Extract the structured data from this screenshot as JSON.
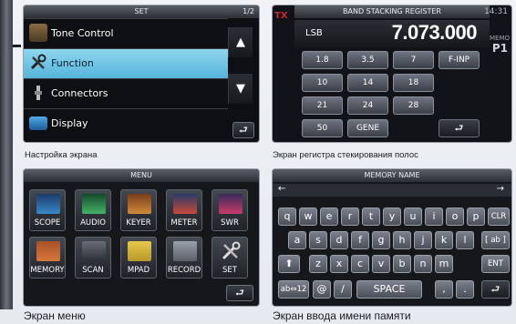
{
  "set_screen": {
    "title": "SET",
    "page_indicator": "1/2",
    "items": [
      {
        "label": "Tone Control",
        "icon": "speaker-icon",
        "selected": false
      },
      {
        "label": "Function",
        "icon": "tools-icon",
        "selected": true
      },
      {
        "label": "Connectors",
        "icon": "connector-icon",
        "selected": false
      },
      {
        "label": "Display",
        "icon": "monitor-icon",
        "selected": false
      }
    ],
    "up_symbol": "▲",
    "down_symbol": "▼",
    "return_symbol": "⮐"
  },
  "band_screen": {
    "title": "BAND STACKING REGISTER",
    "tx_label": "TX",
    "time": "14:31",
    "mode": "LSB",
    "frequency": "7.073.000",
    "memo_label": "MEMO",
    "memo_channel": "P1",
    "bands": [
      "1.8",
      "3.5",
      "7",
      "F-INP",
      "10",
      "14",
      "18",
      "21",
      "24",
      "28",
      "50",
      "GENE"
    ],
    "return_symbol": "⮐"
  },
  "menu_screen": {
    "title": "MENU",
    "items": [
      {
        "label": "SCOPE",
        "icon": "scope-icon"
      },
      {
        "label": "AUDIO",
        "icon": "audio-icon"
      },
      {
        "label": "KEYER",
        "icon": "keyer-icon"
      },
      {
        "label": "METER",
        "icon": "meter-icon"
      },
      {
        "label": "SWR",
        "icon": "swr-icon"
      },
      {
        "label": "MEMORY",
        "icon": "memory-icon"
      },
      {
        "label": "SCAN",
        "icon": "scan-icon"
      },
      {
        "label": "MPAD",
        "icon": "mpad-icon"
      },
      {
        "label": "RECORD",
        "icon": "record-icon"
      },
      {
        "label": "SET",
        "icon": "set-icon"
      }
    ],
    "return_symbol": "⮐"
  },
  "keyboard_screen": {
    "title": "MEMORY NAME",
    "left_arrow": "←",
    "right_arrow": "→",
    "row1": [
      "q",
      "w",
      "e",
      "r",
      "t",
      "y",
      "u",
      "i",
      "o",
      "p"
    ],
    "row2": [
      "a",
      "s",
      "d",
      "f",
      "g",
      "h",
      "j",
      "k",
      "l"
    ],
    "row3": [
      "z",
      "x",
      "c",
      "v",
      "b",
      "n",
      "m"
    ],
    "shift_symbol": "⬆",
    "clr": "CLR",
    "mode_ab": "[ ab ]",
    "ent": "ENT",
    "mode_ab12": "ab⇔12",
    "at": "@",
    "slash": "/",
    "space": "SPACE",
    "comma": ",",
    "period": ".",
    "return_symbol": "⮐"
  },
  "captions": {
    "set": "Настройка экрана",
    "band": "Экран регистра стекирования полос",
    "menu": "Экран меню",
    "keyboard": "Экран ввода имени памяти"
  }
}
